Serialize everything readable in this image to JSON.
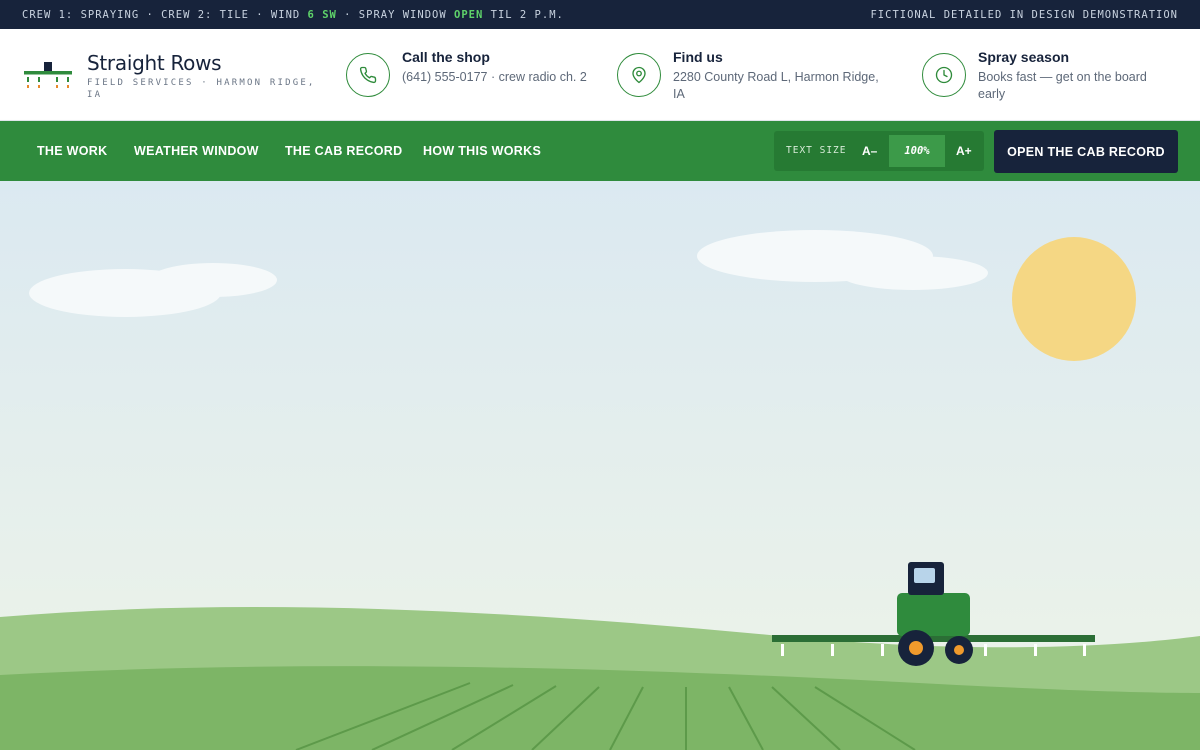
{
  "ticker": {
    "part1": "CREW 1: SPRAYING · CREW 2: TILE · WIND ",
    "wind_value": "6 SW",
    "part2": " · SPRAY WINDOW ",
    "window_status": "OPEN",
    "part3": " TIL 2 P.M.",
    "right": "FICTIONAL DETAILED IN DESIGN DEMONSTRATION"
  },
  "brand": {
    "name": "Straight Rows",
    "sub": "FIELD SERVICES · HARMON RIDGE, IA"
  },
  "info": [
    {
      "icon": "phone-icon",
      "title": "Call the shop",
      "text": "(641) 555-0177 · crew radio ch. 2"
    },
    {
      "icon": "map-pin-icon",
      "title": "Find us",
      "text": "2280 County Road L, Harmon Ridge, IA"
    },
    {
      "icon": "clock-icon",
      "title": "Spray season",
      "text": "Books fast — get on the board early"
    }
  ],
  "nav": {
    "links": [
      "THE WORK",
      "WEATHER WINDOW",
      "THE CAB RECORD",
      "HOW THIS WORKS"
    ],
    "text_size_label": "TEXT SIZE",
    "decrease": "A–",
    "zoom": "100%",
    "increase": "A+",
    "cta": "OPEN THE CAB RECORD"
  },
  "colors": {
    "ticker_bg": "#17233b",
    "highlight": "#5fd36a",
    "nav_green": "#2f8b3d",
    "cta_navy": "#17233b",
    "sun": "#f5d784",
    "hill_light": "#9cc886",
    "hill_dark": "#7db566"
  }
}
